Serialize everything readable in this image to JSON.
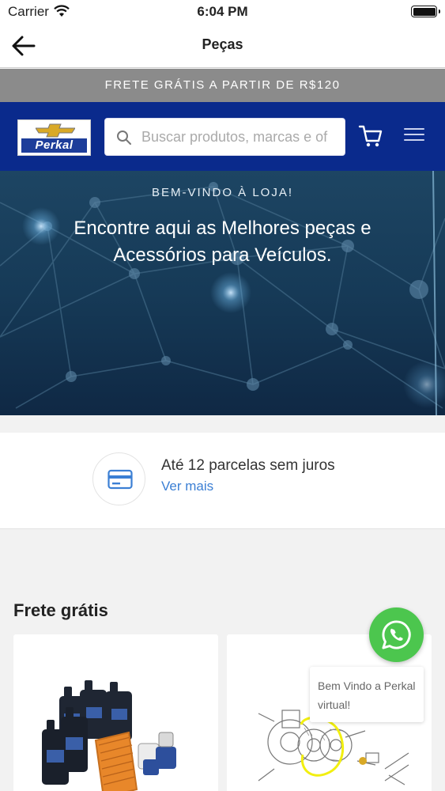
{
  "status_bar": {
    "carrier": "Carrier",
    "time": "6:04 PM"
  },
  "nav": {
    "title": "Peças",
    "back_icon": "arrow-left-icon"
  },
  "promo": {
    "text": "FRETE GRÁTIS A PARTIR DE R$120",
    "background": "#8b8b8b"
  },
  "header": {
    "background": "#0a2a8c",
    "logo_text": "Perkal",
    "search_placeholder": "Buscar produtos, marcas e of",
    "icons": [
      "search-icon",
      "cart-icon",
      "hamburger-menu-icon"
    ]
  },
  "hero": {
    "kicker": "BEM-VINDO À LOJA!",
    "headline_line1": "Encontre aqui as Melhores peças e",
    "headline_line2": "Acessórios para Veículos."
  },
  "installments": {
    "title": "Até 12 parcelas sem juros",
    "link": "Ver mais",
    "icon": "credit-card-icon",
    "accent": "#3b7fd4"
  },
  "free_shipping": {
    "section_title": "Frete grátis",
    "products": [
      {
        "image": "oil-bottles-and-filters"
      },
      {
        "image": "clutch-kit-diagram"
      }
    ]
  },
  "chat": {
    "icon": "whatsapp-icon",
    "message": "Bem Vindo a Perkal virtual!",
    "color": "#4cc64e"
  }
}
